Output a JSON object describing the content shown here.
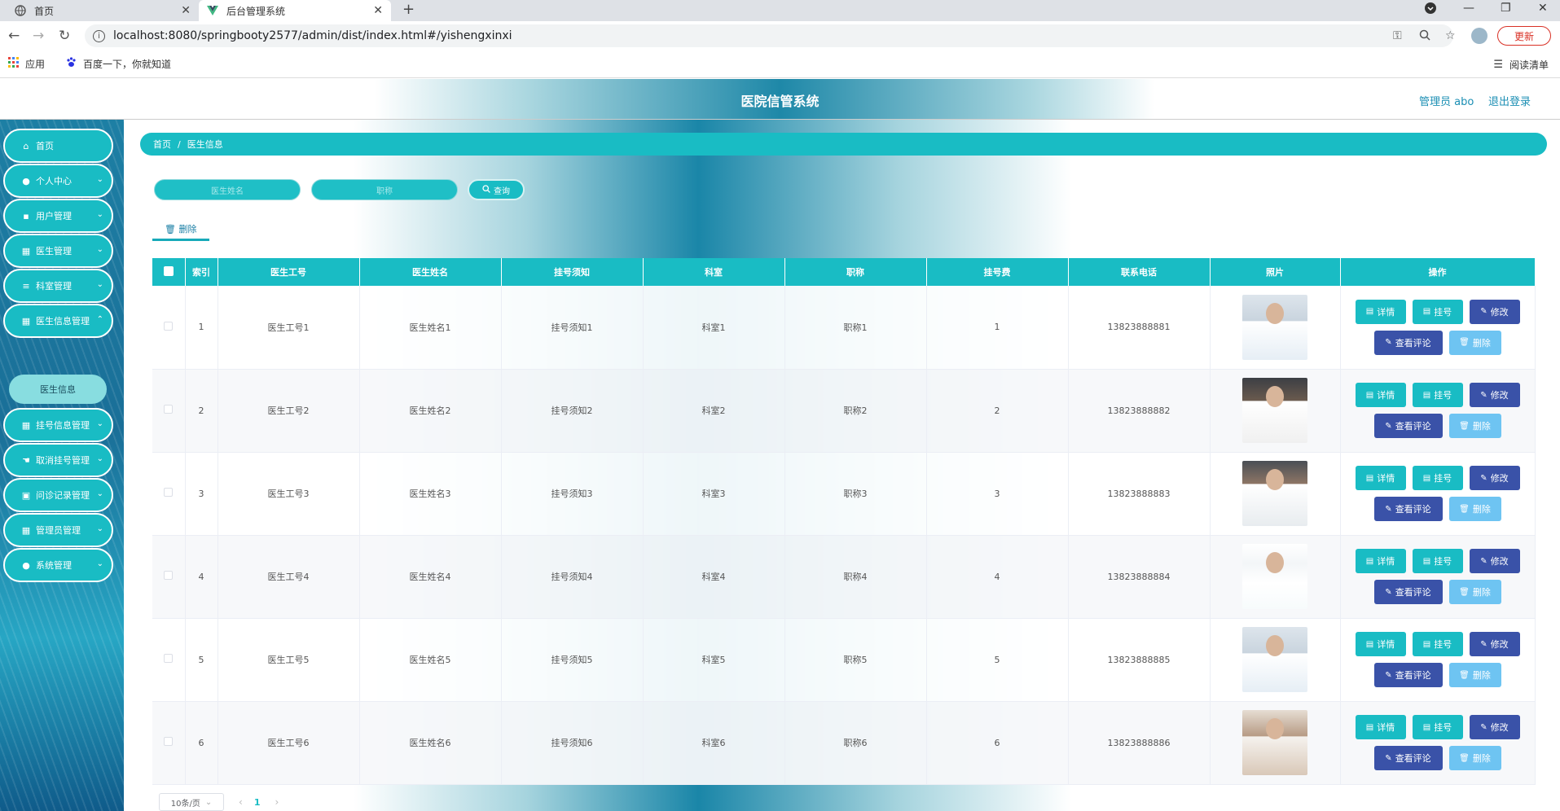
{
  "browser": {
    "tabs": [
      {
        "title": "首页",
        "icon": "globe-icon"
      },
      {
        "title": "后台管理系统",
        "icon": "vue-logo-icon"
      }
    ],
    "url": "localhost:8080/springbooty2577/admin/dist/index.html#/yishengxinxi",
    "update_label": "更新",
    "bookmarks": [
      {
        "label": "应用",
        "icon": "apps-grid-icon"
      },
      {
        "label": "百度一下，你就知道",
        "icon": "baidu-paw-icon"
      }
    ],
    "reading_list_label": "阅读清单"
  },
  "header": {
    "title": "医院信管系统",
    "user_label": "管理员 abo",
    "logout_label": "退出登录"
  },
  "sidebar": {
    "items": [
      {
        "label": "首页",
        "icon": "home-icon",
        "has_chevron": false
      },
      {
        "label": "个人中心",
        "icon": "user-icon",
        "has_chevron": true
      },
      {
        "label": "用户管理",
        "icon": "chat-icon",
        "has_chevron": true
      },
      {
        "label": "医生管理",
        "icon": "grid-icon",
        "has_chevron": true
      },
      {
        "label": "科室管理",
        "icon": "sliders-icon",
        "has_chevron": true
      },
      {
        "label": "医生信息管理",
        "icon": "grid-icon",
        "has_chevron": true,
        "expanded": true
      },
      {
        "label": "挂号信息管理",
        "icon": "grid-icon",
        "has_chevron": true
      },
      {
        "label": "取消挂号管理",
        "icon": "thumb-icon",
        "has_chevron": true
      },
      {
        "label": "问诊记录管理",
        "icon": "wallet-icon",
        "has_chevron": true
      },
      {
        "label": "管理员管理",
        "icon": "grid-icon",
        "has_chevron": true
      },
      {
        "label": "系统管理",
        "icon": "bulb-icon",
        "has_chevron": true
      }
    ],
    "sub_item": "医生信息"
  },
  "breadcrumb": {
    "home": "首页",
    "separator": "/",
    "current": "医生信息"
  },
  "search": {
    "name_placeholder": "医生姓名",
    "title_placeholder": "职称",
    "button_label": "查询"
  },
  "toolbar": {
    "delete_label": "删除"
  },
  "table": {
    "headers": [
      "索引",
      "医生工号",
      "医生姓名",
      "挂号须知",
      "科室",
      "职称",
      "挂号费",
      "联系电话",
      "照片",
      "操作"
    ],
    "rows": [
      {
        "index": "1",
        "id": "医生工号1",
        "name": "医生姓名1",
        "notice": "挂号须知1",
        "dept": "科室1",
        "title": "职称1",
        "fee": "1",
        "phone": "13823888881"
      },
      {
        "index": "2",
        "id": "医生工号2",
        "name": "医生姓名2",
        "notice": "挂号须知2",
        "dept": "科室2",
        "title": "职称2",
        "fee": "2",
        "phone": "13823888882"
      },
      {
        "index": "3",
        "id": "医生工号3",
        "name": "医生姓名3",
        "notice": "挂号须知3",
        "dept": "科室3",
        "title": "职称3",
        "fee": "3",
        "phone": "13823888883"
      },
      {
        "index": "4",
        "id": "医生工号4",
        "name": "医生姓名4",
        "notice": "挂号须知4",
        "dept": "科室4",
        "title": "职称4",
        "fee": "4",
        "phone": "13823888884"
      },
      {
        "index": "5",
        "id": "医生工号5",
        "name": "医生姓名5",
        "notice": "挂号须知5",
        "dept": "科室5",
        "title": "职称5",
        "fee": "5",
        "phone": "13823888885"
      },
      {
        "index": "6",
        "id": "医生工号6",
        "name": "医生姓名6",
        "notice": "挂号须知6",
        "dept": "科室6",
        "title": "职称6",
        "fee": "6",
        "phone": "13823888886"
      }
    ],
    "actions": {
      "detail": "详情",
      "register": "挂号",
      "edit": "修改",
      "comments": "查看评论",
      "delete": "删除"
    }
  },
  "pagination": {
    "page_size": "10条/页",
    "current_page": "1"
  },
  "colors": {
    "accent": "#19bcc4",
    "navy_button": "#3a52a8",
    "light_button": "#6ec4f2",
    "link": "#1c8fb4"
  }
}
